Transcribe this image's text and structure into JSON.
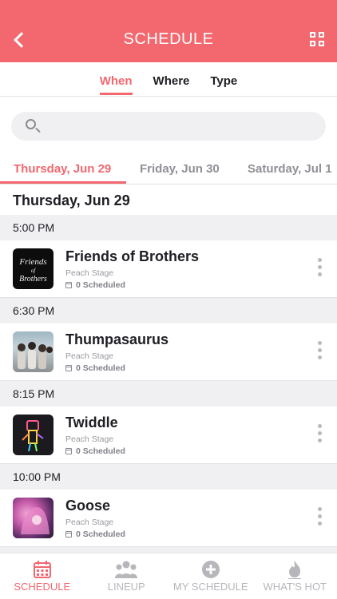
{
  "header": {
    "title": "SCHEDULE"
  },
  "filter_tabs": [
    {
      "label": "When",
      "active": true
    },
    {
      "label": "Where",
      "active": false
    },
    {
      "label": "Type",
      "active": false
    }
  ],
  "search": {
    "placeholder": "",
    "value": ""
  },
  "day_tabs": [
    {
      "label": "Thursday, Jun 29",
      "active": true
    },
    {
      "label": "Friday, Jun 30",
      "active": false
    },
    {
      "label": "Saturday, Jul 1",
      "active": false
    }
  ],
  "section_title": "Thursday, Jun 29",
  "slots": [
    {
      "time": "5:00 PM",
      "artist": "Friends of Brothers",
      "stage": "Peach Stage",
      "scheduled": "0 Scheduled",
      "thumb": "friends-of-brothers-logo"
    },
    {
      "time": "6:30 PM",
      "artist": "Thumpasaurus",
      "stage": "Peach Stage",
      "scheduled": "0 Scheduled",
      "thumb": "band-photo"
    },
    {
      "time": "8:15 PM",
      "artist": "Twiddle",
      "stage": "Peach Stage",
      "scheduled": "0 Scheduled",
      "thumb": "neon-figure-art"
    },
    {
      "time": "10:00 PM",
      "artist": "Goose",
      "stage": "Peach Stage",
      "scheduled": "0 Scheduled",
      "thumb": "pink-hair-art"
    }
  ],
  "tabbar": [
    {
      "label": "SCHEDULE",
      "icon": "calendar-icon",
      "active": true
    },
    {
      "label": "LINEUP",
      "icon": "people-icon",
      "active": false
    },
    {
      "label": "MY SCHEDULE",
      "icon": "plus-circle-icon",
      "active": false
    },
    {
      "label": "WHAT'S HOT",
      "icon": "flame-icon",
      "active": false
    }
  ],
  "colors": {
    "accent": "#f3676f",
    "muted": "#b6b6bb"
  }
}
